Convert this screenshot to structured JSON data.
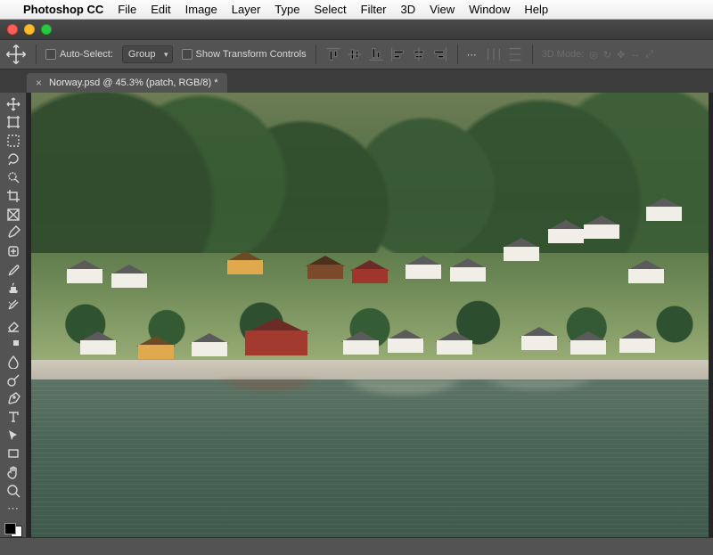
{
  "menubar": {
    "app": "Photoshop CC",
    "items": [
      "File",
      "Edit",
      "Image",
      "Layer",
      "Type",
      "Select",
      "Filter",
      "3D",
      "View",
      "Window",
      "Help"
    ]
  },
  "options": {
    "auto_select_label": "Auto-Select:",
    "group_select": "Group",
    "show_transform_label": "Show Transform Controls",
    "mode3d_label": "3D Mode:"
  },
  "document": {
    "tab_label": "Norway.psd @ 45.3% (patch, RGB/8) *"
  },
  "tools": [
    "move-tool",
    "artboard-tool",
    "marquee-tool",
    "lasso-tool",
    "quick-select-tool",
    "crop-tool",
    "frame-tool",
    "eyedropper-tool",
    "healing-brush-tool",
    "brush-tool",
    "clone-stamp-tool",
    "history-brush-tool",
    "eraser-tool",
    "gradient-tool",
    "blur-tool",
    "dodge-tool",
    "pen-tool",
    "type-tool",
    "path-select-tool",
    "rectangle-tool",
    "hand-tool",
    "zoom-tool",
    "edit-toolbar",
    "foreground-background"
  ],
  "status": {
    "text": ""
  }
}
